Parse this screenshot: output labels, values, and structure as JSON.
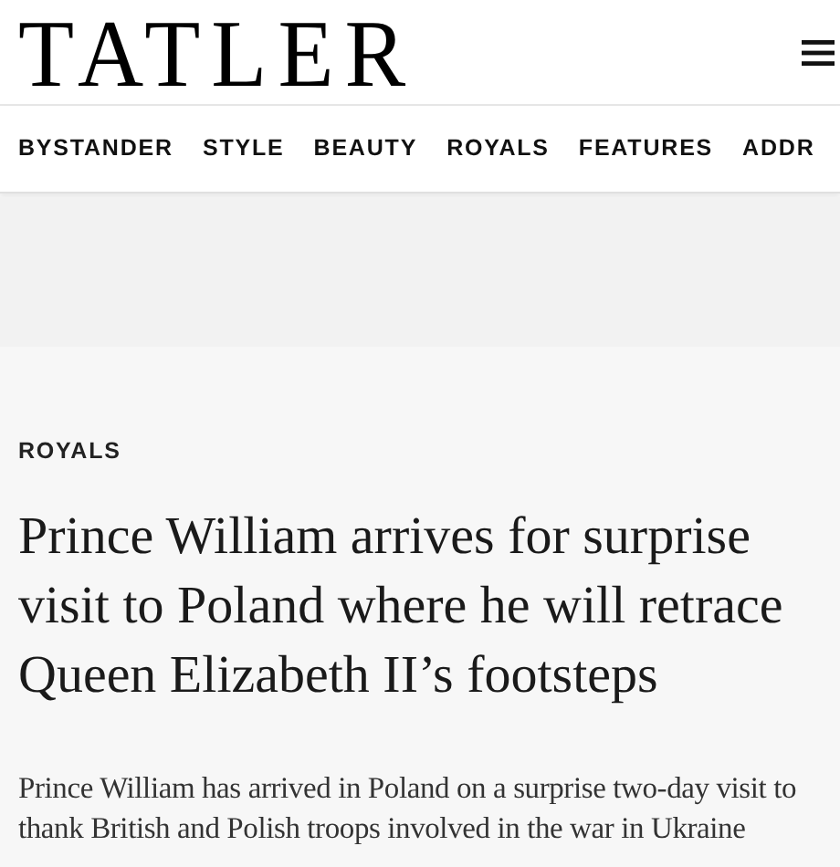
{
  "header": {
    "logo": "TATLER"
  },
  "nav": {
    "items": [
      "BYSTANDER",
      "STYLE",
      "BEAUTY",
      "ROYALS",
      "FEATURES",
      "ADDR"
    ]
  },
  "article": {
    "category": "ROYALS",
    "headline": "Prince William arrives for surprise visit to Poland where he will retrace Queen Elizabeth II’s footsteps",
    "standfirst": "Prince William has arrived in Poland on a surprise two-day visit to thank British and Polish troops involved in the war in Ukraine"
  }
}
